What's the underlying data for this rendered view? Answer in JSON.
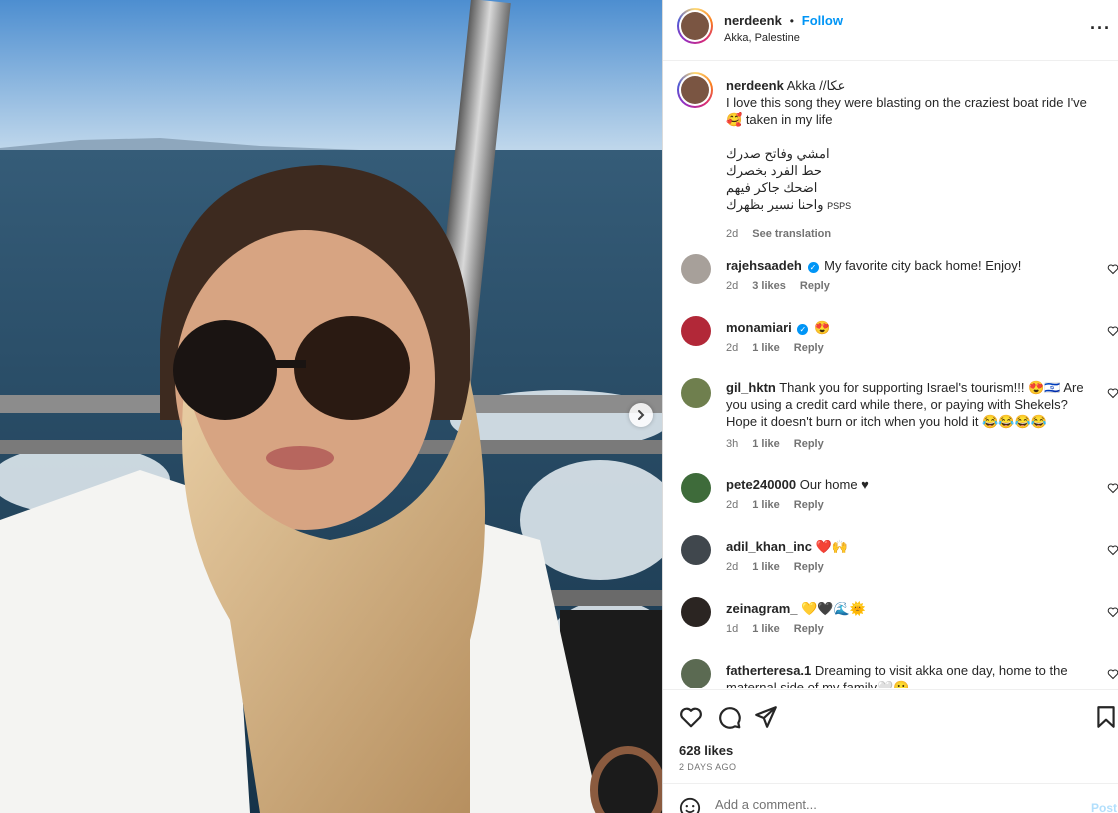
{
  "header": {
    "username": "nerdeenk",
    "dot": "•",
    "follow_label": "Follow",
    "location": "Akka, Palestine",
    "more": "···"
  },
  "caption": {
    "username": "nerdeenk",
    "text1": "Akka //عكا",
    "text2": "I love this song they were blasting on the craziest boat ride I've",
    "text3": "taken in my life",
    "emoji": "🥰",
    "arabic1": "امشي وفاتح صدرك",
    "arabic2": "حط الفرد بخصرك",
    "arabic3": "اضحك جاكر فيهم",
    "arabic4": "واحنا نسير بظهرك",
    "psps": "PSPS",
    "time": "2d",
    "see_translation": "See translation"
  },
  "comments": [
    {
      "username": "rajehsaadeh",
      "verified": true,
      "text": "My favorite city back home! Enjoy!",
      "time": "2d",
      "likes": "3 likes",
      "reply": "Reply"
    },
    {
      "username": "monamiari",
      "verified": true,
      "text": "😍",
      "time": "2d",
      "likes": "1 like",
      "reply": "Reply"
    },
    {
      "username": "gil_hktn",
      "verified": false,
      "line1": "Thank you for supporting Israel's tourism!!! 😍🇮🇱 Are",
      "line2": "you using a credit card while there, or paying with Shekels?",
      "line3": "Hope it doesn't burn or itch when you hold it 😂😂😂😂",
      "time": "3h",
      "likes": "1 like",
      "reply": "Reply"
    },
    {
      "username": "pete240000",
      "verified": false,
      "text": "Our home ♥",
      "time": "2d",
      "likes": "1 like",
      "reply": "Reply"
    },
    {
      "username": "adil_khan_inc",
      "verified": false,
      "text": "❤️🙌",
      "time": "2d",
      "likes": "1 like",
      "reply": "Reply"
    },
    {
      "username": "zeinagram_",
      "verified": false,
      "text": "💛🖤🌊🌞",
      "time": "1d",
      "likes": "1 like",
      "reply": "Reply"
    },
    {
      "username": "fatherteresa.1",
      "verified": false,
      "line1": "Dreaming to visit akka one day, home to the",
      "line2": "maternal side of my family🤍🥲"
    }
  ],
  "actions": {
    "likes": "628 likes",
    "date": "2 DAYS AGO",
    "add_placeholder": "Add a comment...",
    "post_label": "Post"
  },
  "colors": {
    "accent": "#0095f6",
    "text": "#262626",
    "muted": "#737373",
    "post_disabled": "#b2dffc"
  }
}
